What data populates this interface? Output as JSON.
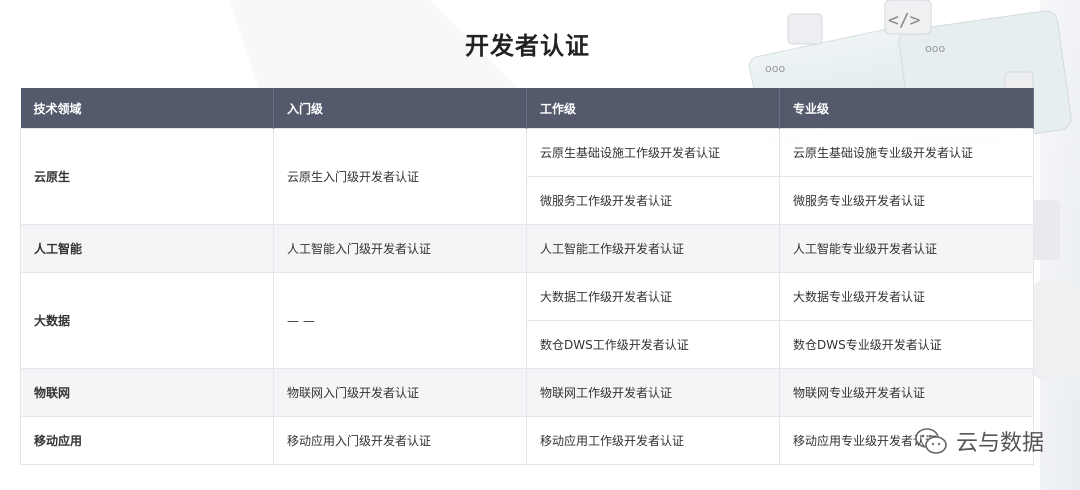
{
  "page": {
    "title": "开发者认证"
  },
  "table": {
    "headers": [
      "技术领域",
      "入门级",
      "工作级",
      "专业级"
    ],
    "rows": [
      {
        "domain": "云原生",
        "entry": "云原生入门级开发者认证",
        "work": [
          "云原生基础设施工作级开发者认证",
          "微服务工作级开发者认证"
        ],
        "pro": [
          "云原生基础设施专业级开发者认证",
          "微服务专业级开发者认证"
        ]
      },
      {
        "domain": "人工智能",
        "entry": "人工智能入门级开发者认证",
        "work": [
          "人工智能工作级开发者认证"
        ],
        "pro": [
          "人工智能专业级开发者认证"
        ]
      },
      {
        "domain": "大数据",
        "entry": "— —",
        "work": [
          "大数据工作级开发者认证",
          "数仓DWS工作级开发者认证"
        ],
        "pro": [
          "大数据专业级开发者认证",
          "数仓DWS专业级开发者认证"
        ]
      },
      {
        "domain": "物联网",
        "entry": "物联网入门级开发者认证",
        "work": [
          "物联网工作级开发者认证"
        ],
        "pro": [
          "物联网专业级开发者认证"
        ]
      },
      {
        "domain": "移动应用",
        "entry": "移动应用入门级开发者认证",
        "work": [
          "移动应用工作级开发者认证"
        ],
        "pro": [
          "移动应用专业级开发者认证"
        ]
      }
    ]
  },
  "watermark": {
    "text": "云与数据",
    "icon": "wechat-icon"
  },
  "decoration": {
    "code_icon": "</>",
    "dots": "ooo"
  }
}
